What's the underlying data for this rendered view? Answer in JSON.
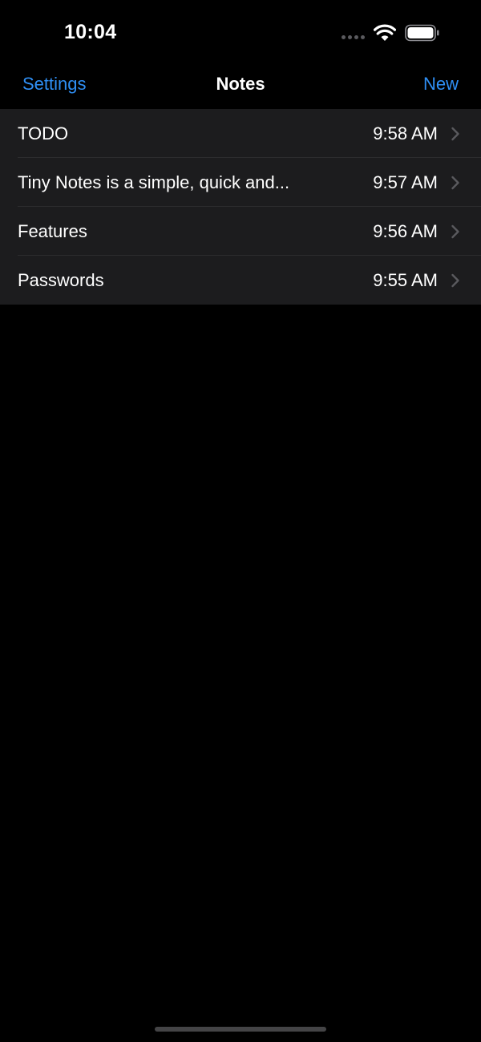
{
  "status_bar": {
    "time": "10:04"
  },
  "nav": {
    "left_label": "Settings",
    "title": "Notes",
    "right_label": "New"
  },
  "notes": [
    {
      "title": "TODO",
      "time": "9:58 AM"
    },
    {
      "title": "Tiny Notes is a simple, quick and...",
      "time": "9:57 AM"
    },
    {
      "title": "Features",
      "time": "9:56 AM"
    },
    {
      "title": "Passwords",
      "time": "9:55 AM"
    }
  ],
  "colors": {
    "accent": "#2f8ff5",
    "background": "#000000",
    "list_background": "#1c1c1e",
    "divider": "#2c2c2e"
  },
  "icons": {
    "wifi": "wifi-icon",
    "battery": "battery-icon",
    "signal": "signal-dots-icon",
    "row_disclosure": "chevron-right-icon"
  }
}
